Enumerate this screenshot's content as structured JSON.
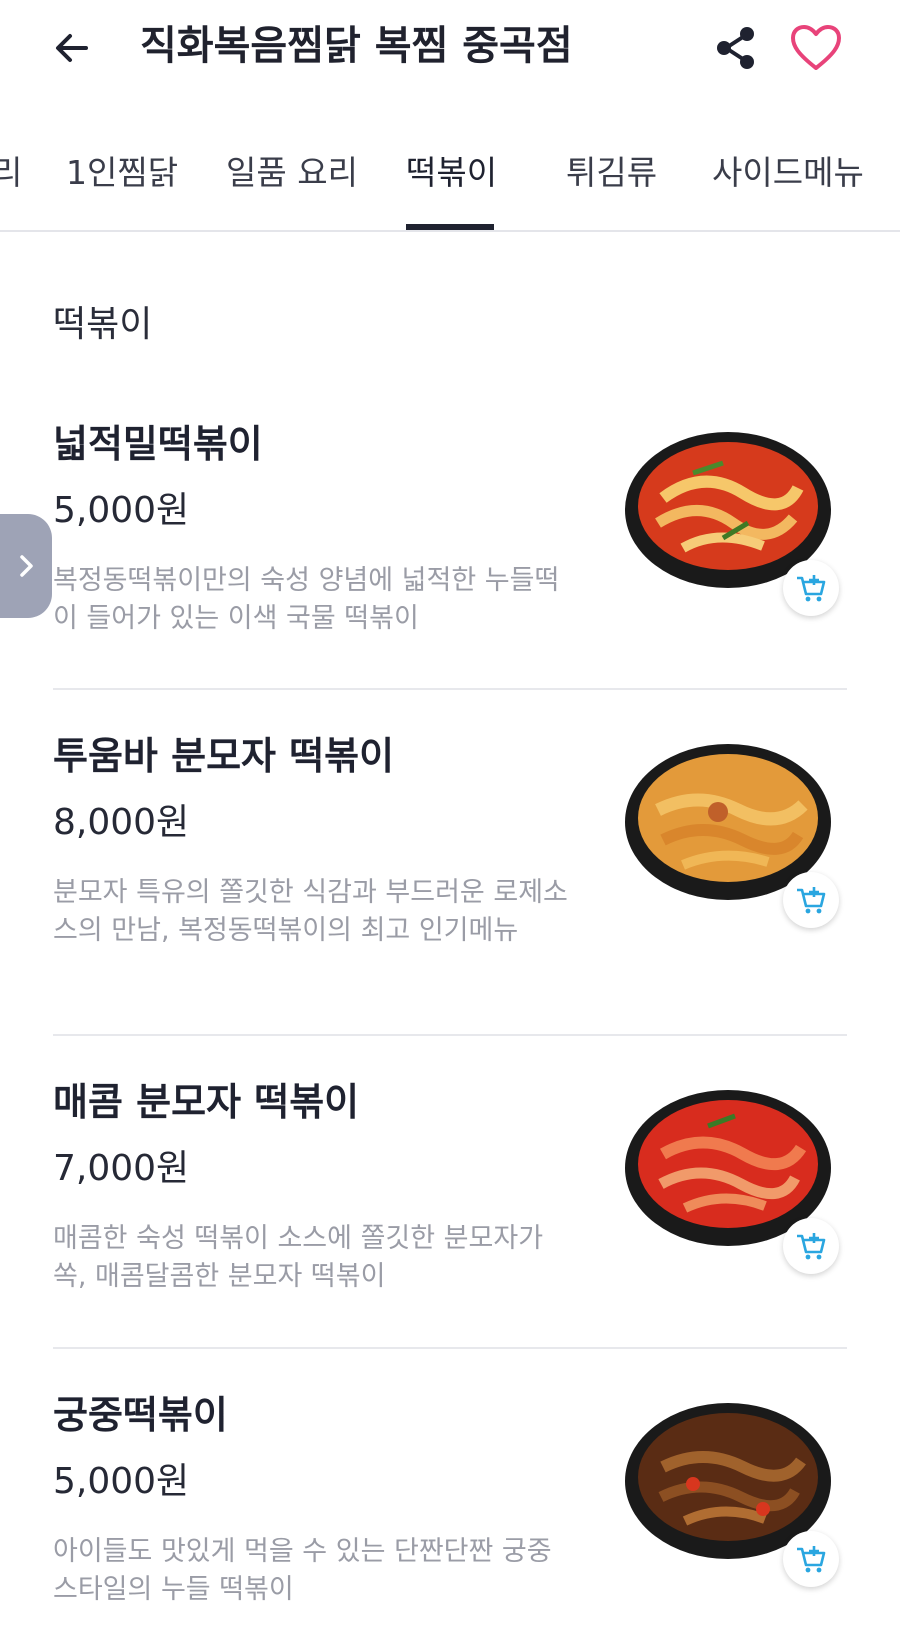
{
  "header": {
    "title": "직화복음찜닭 복찜 중곡점",
    "back_icon": "arrow-left-icon",
    "share_icon": "share-icon",
    "favorite_icon": "heart-icon",
    "favorite_color": "#e8437a"
  },
  "tabs": [
    {
      "label": "리"
    },
    {
      "label": "1인찜닭"
    },
    {
      "label": "일품 요리"
    },
    {
      "label": "떡볶이",
      "active": true
    },
    {
      "label": "튀김류"
    },
    {
      "label": "사이드메뉴"
    }
  ],
  "section": {
    "title": "떡볶이"
  },
  "menu_items": [
    {
      "name": "넓적밀떡볶이",
      "price": "5,000원",
      "description": "복정동떡볶이만의 숙성 양념에 넓적한 누들떡이 들어가 있는 이색 국물 떡볶이"
    },
    {
      "name": "투움바 분모자 떡볶이",
      "price": "8,000원",
      "description": "분모자 특유의 쫄깃한 식감과 부드러운 로제소스의 만남, 복정동떡볶이의 최고 인기메뉴"
    },
    {
      "name": "매콤 분모자 떡볶이",
      "price": "7,000원",
      "description": "매콤한 숙성 떡볶이 소스에 쫄깃한 분모자가 쏙, 매콤달콤한 분모자 떡볶이"
    },
    {
      "name": "궁중떡볶이",
      "price": "5,000원",
      "description": "아이들도 맛있게 먹을 수 있는 단짠단짠 궁중 스타일의 누들 떡볶이"
    }
  ],
  "icons": {
    "cart": "cart-plus-icon",
    "side_toggle": "chevron-right-icon"
  },
  "colors": {
    "accent_blue": "#2aa6e0",
    "text_primary": "#1f2230",
    "text_muted": "#9a9ca6",
    "side_toggle": "#9ea3b6"
  }
}
